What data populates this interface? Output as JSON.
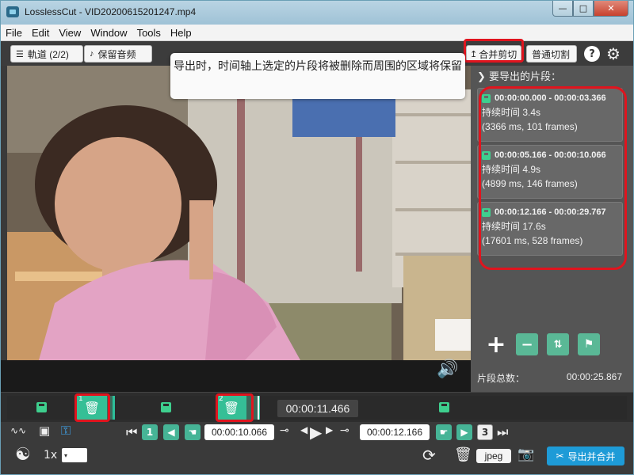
{
  "window": {
    "title": "LosslessCut - VID20200615201247.mp4"
  },
  "menu": [
    "File",
    "Edit",
    "View",
    "Window",
    "Tools",
    "Help"
  ],
  "toolbar": {
    "tracks_label": "軌道 (2/2)",
    "keep_audio_label": "保留音频",
    "merge_cut_label": "合并剪切",
    "normal_cut_label": "普通切割",
    "help_label": "?"
  },
  "tooltip": {
    "text": "导出时，时间轴上选定的片段将被删除而周围的区域将保留"
  },
  "panel": {
    "title": "要导出的片段：",
    "segments": [
      {
        "range": "00:00:00.000 - 00:00:03.366",
        "duration": "持续时间 3.4s",
        "frames": "(3366 ms, 101 frames)"
      },
      {
        "range": "00:00:05.166 - 00:00:10.066",
        "duration": "持续时间 4.9s",
        "frames": "(4899 ms, 146 frames)"
      },
      {
        "range": "00:00:12.166 - 00:00:29.767",
        "duration": "持续时间 17.6s",
        "frames": "(17601 ms, 528 frames)"
      }
    ],
    "total_label": "片段总数：",
    "total_value": "00:00:25.867"
  },
  "timeline": {
    "current_time": "00:00:11.466",
    "seg1_num": "1",
    "seg2_num": "2"
  },
  "controls": {
    "seg_num_left": "1",
    "start_time": "00:00:10.066",
    "end_time": "00:00:12.166",
    "seg_num_right": "3",
    "speed": "1x",
    "format": "jpeg",
    "export_label": "导出并合并"
  },
  "colors": {
    "accent_green": "#46b496",
    "export_blue": "#1e9bd7",
    "highlight_red": "#e0141e"
  }
}
